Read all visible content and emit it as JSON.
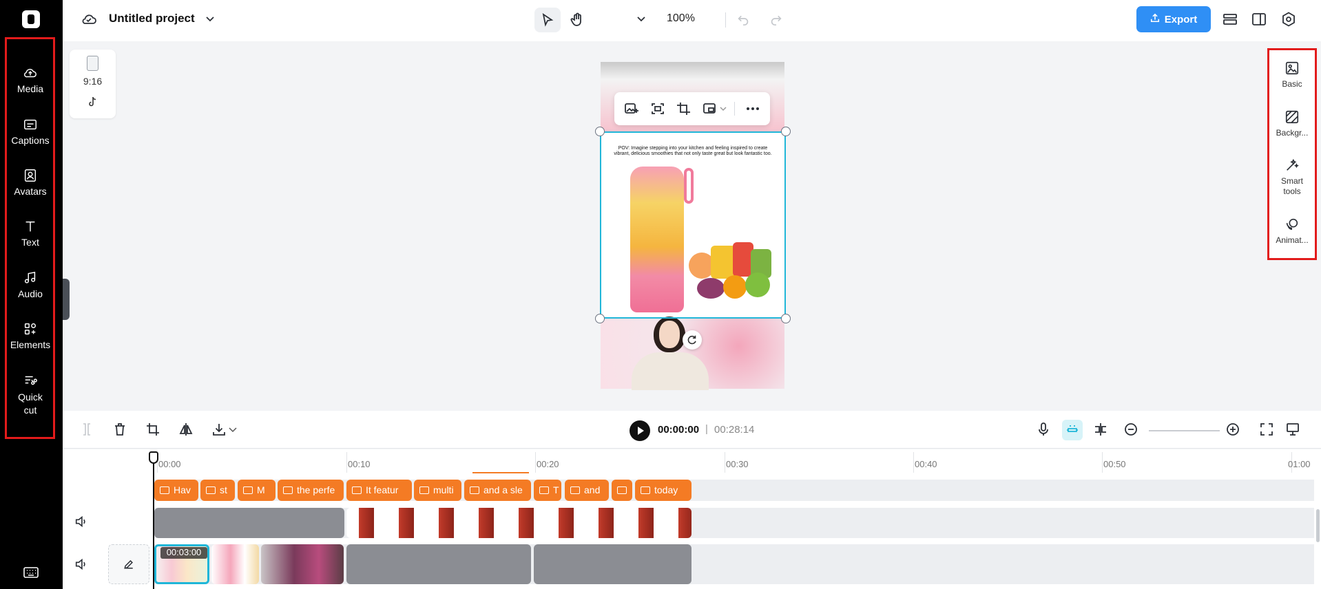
{
  "sidebar": {
    "items": [
      {
        "label": "Media",
        "icon": "cloud-upload-icon"
      },
      {
        "label": "Captions",
        "icon": "captions-icon"
      },
      {
        "label": "Avatars",
        "icon": "avatar-icon"
      },
      {
        "label": "Text",
        "icon": "text-icon"
      },
      {
        "label": "Audio",
        "icon": "music-note-icon"
      },
      {
        "label": "Elements",
        "icon": "elements-icon"
      },
      {
        "label": "Quick",
        "label2": "cut",
        "icon": "quick-cut-icon"
      }
    ]
  },
  "topbar": {
    "project_title": "Untitled project",
    "zoom": "100%",
    "export_label": "Export"
  },
  "canvas": {
    "aspect_ratio": "9:16",
    "caption_text": "POV: Imagine stepping into your kitchen and feeling inspired to create vibrant, delicious smoothies that not only taste great but look fantastic too."
  },
  "right_panel": {
    "items": [
      {
        "label": "Basic",
        "icon": "image-icon"
      },
      {
        "label": "Backgr...",
        "icon": "background-icon"
      },
      {
        "label": "Smart",
        "label2": "tools",
        "icon": "magic-wand-icon"
      },
      {
        "label": "Animat...",
        "icon": "animation-icon"
      }
    ]
  },
  "timeline": {
    "current_time": "00:00:00",
    "separator": "|",
    "total_time": "00:28:14",
    "ruler": [
      "00:00",
      "00:10",
      "00:20",
      "00:30",
      "00:40",
      "00:50",
      "01:00"
    ],
    "captions": [
      "Hav",
      "st",
      "M",
      "the perfe",
      "It featur",
      "multi",
      "and a sle",
      "T",
      "and",
      "",
      "today"
    ],
    "selected_clip_time": "00:03:00"
  },
  "colors": {
    "accent": "#2f8ff5",
    "caption_clip": "#f47b24",
    "selection": "#1fb6d8",
    "highlight_box": "#e21b1b"
  }
}
